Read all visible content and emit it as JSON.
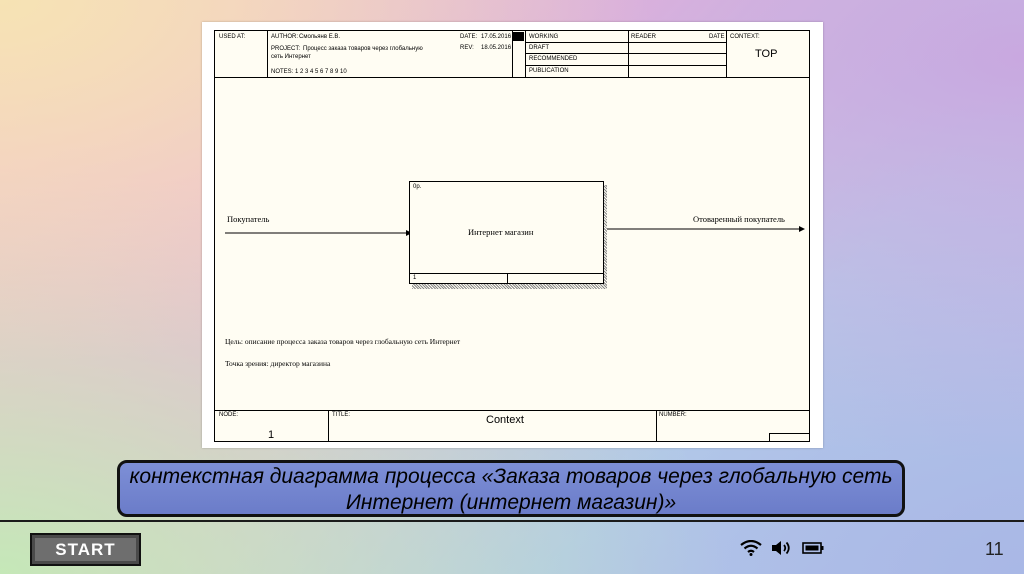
{
  "diagram": {
    "header": {
      "used_at": "USED AT:",
      "author_label": "AUTHOR:",
      "author": "Смольянв Е.В.",
      "project_label": "PROJECT:",
      "project_line1": "Процесс заказа товаров через глобальную",
      "project_line2": "сеть Интернет",
      "date_label": "DATE:",
      "date": "17.05.2016",
      "rev_label": "REV:",
      "rev": "18.05.2016",
      "notes": "NOTES: 1 2 3 4 5 6 7 8 9 10",
      "working": "WORKING",
      "draft": "DRAFT",
      "recommended": "RECOMMENDED",
      "publication": "PUBLICATION",
      "reader": "READER",
      "date2": "DATE",
      "context_label": "CONTEXT:",
      "context_value": "TOP"
    },
    "box": {
      "cost": "0р.",
      "name": "Интернет магазин",
      "number": "1"
    },
    "input_label": "Покупатель",
    "output_label": "Отоваренный покупатель",
    "purpose": "Цель: описание процесса заказа товаров через глобальную сеть Интернет",
    "viewpoint": "Точка зрения: директор магазина",
    "footer": {
      "node_label": "NODE:",
      "node_value": "1",
      "title_label": "TITLE:",
      "title_value": "Context",
      "number_label": "NUMBER:"
    }
  },
  "caption": "контекстная диаграмма процесса «Заказа товаров через глобальную сеть Интернет (интернет магазин)»",
  "taskbar": {
    "start": "START",
    "page_number": "11",
    "icons": [
      "wifi-icon",
      "speaker-icon",
      "battery-icon"
    ]
  }
}
